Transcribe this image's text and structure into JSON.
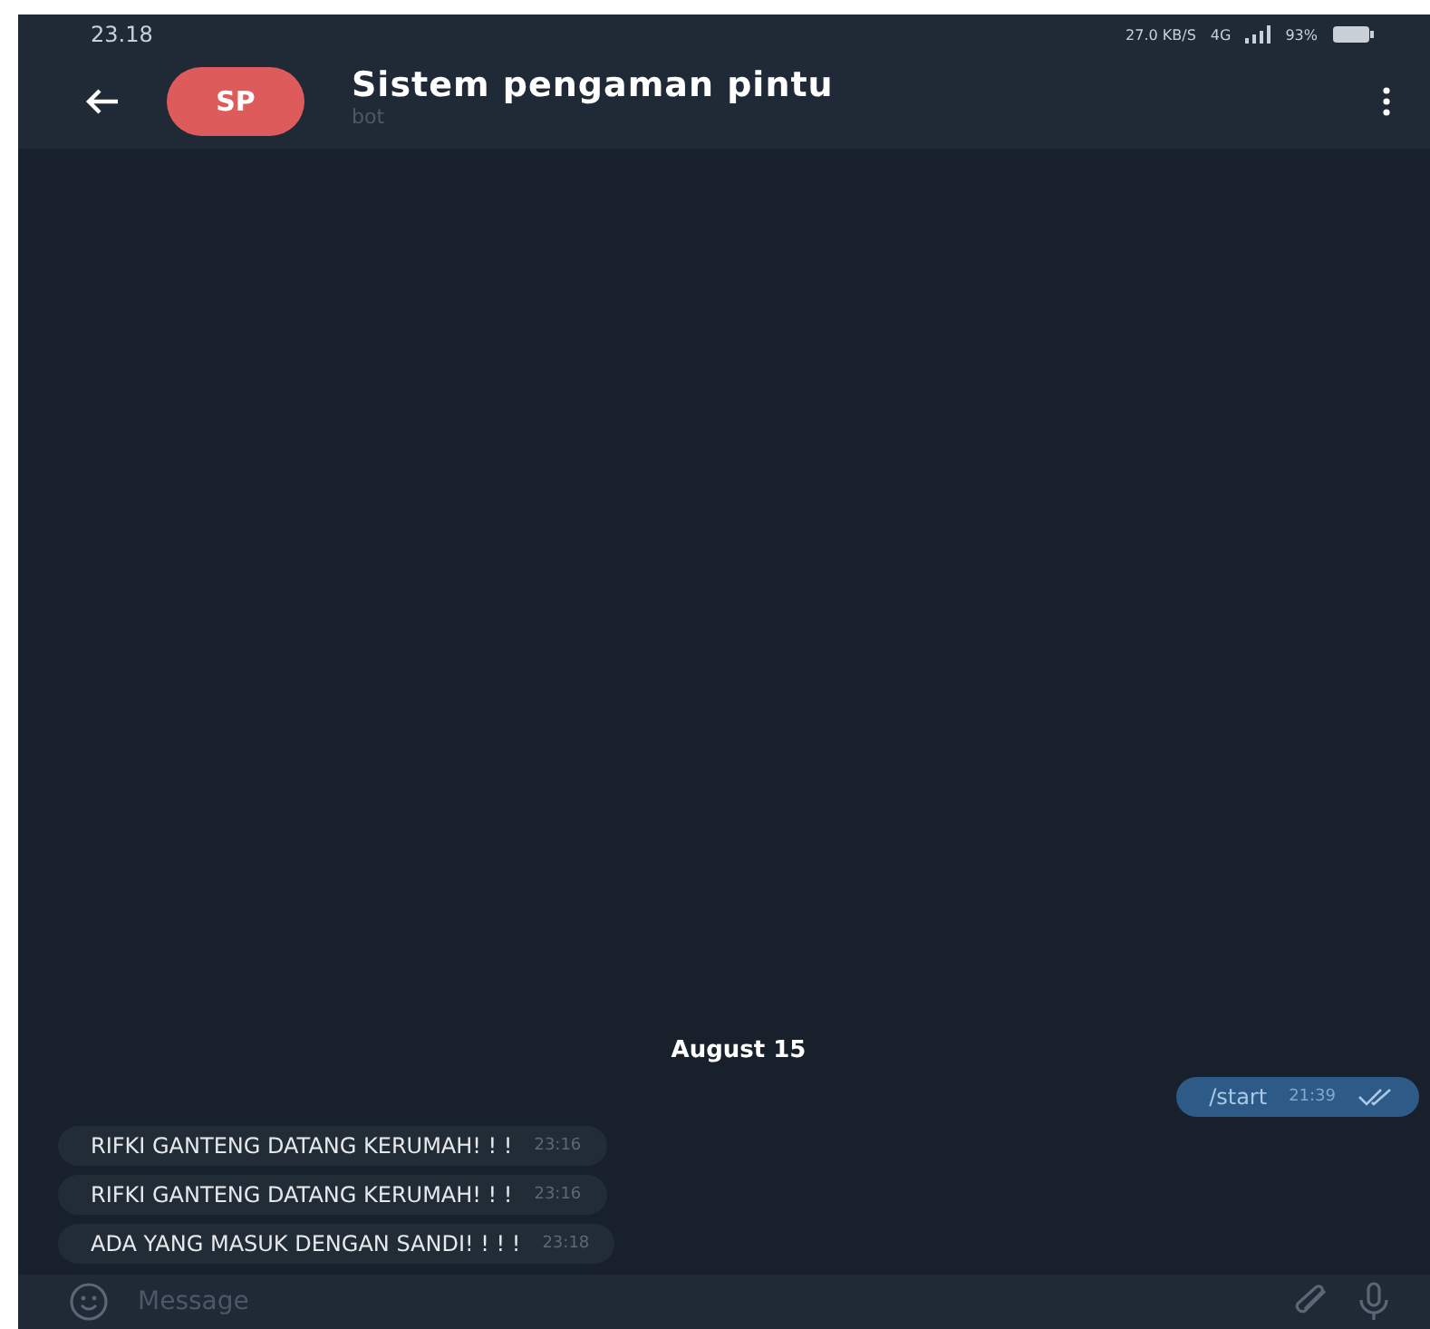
{
  "status_bar": {
    "time": "23.18",
    "speed": "27.0",
    "speed_unit": "KB/S",
    "network": "4G",
    "battery": "93%"
  },
  "header": {
    "avatar": "SP",
    "title": "Sistem pengaman pintu",
    "subtitle": "bot"
  },
  "date_label": "August 15",
  "messages": [
    {
      "kind": "outgoing",
      "text": "/start",
      "time": "21:39",
      "read": true
    },
    {
      "kind": "incoming",
      "text": "RIFKI GANTENG DATANG KERUMAH! ! !",
      "time": "23:16"
    },
    {
      "kind": "incoming",
      "text": "RIFKI GANTENG DATANG KERUMAH! ! !",
      "time": "23:16"
    },
    {
      "kind": "incoming",
      "text": "ADA YANG MASUK DENGAN SANDI! ! ! !",
      "time": "23:18"
    }
  ],
  "composer": {
    "placeholder": "Message"
  }
}
